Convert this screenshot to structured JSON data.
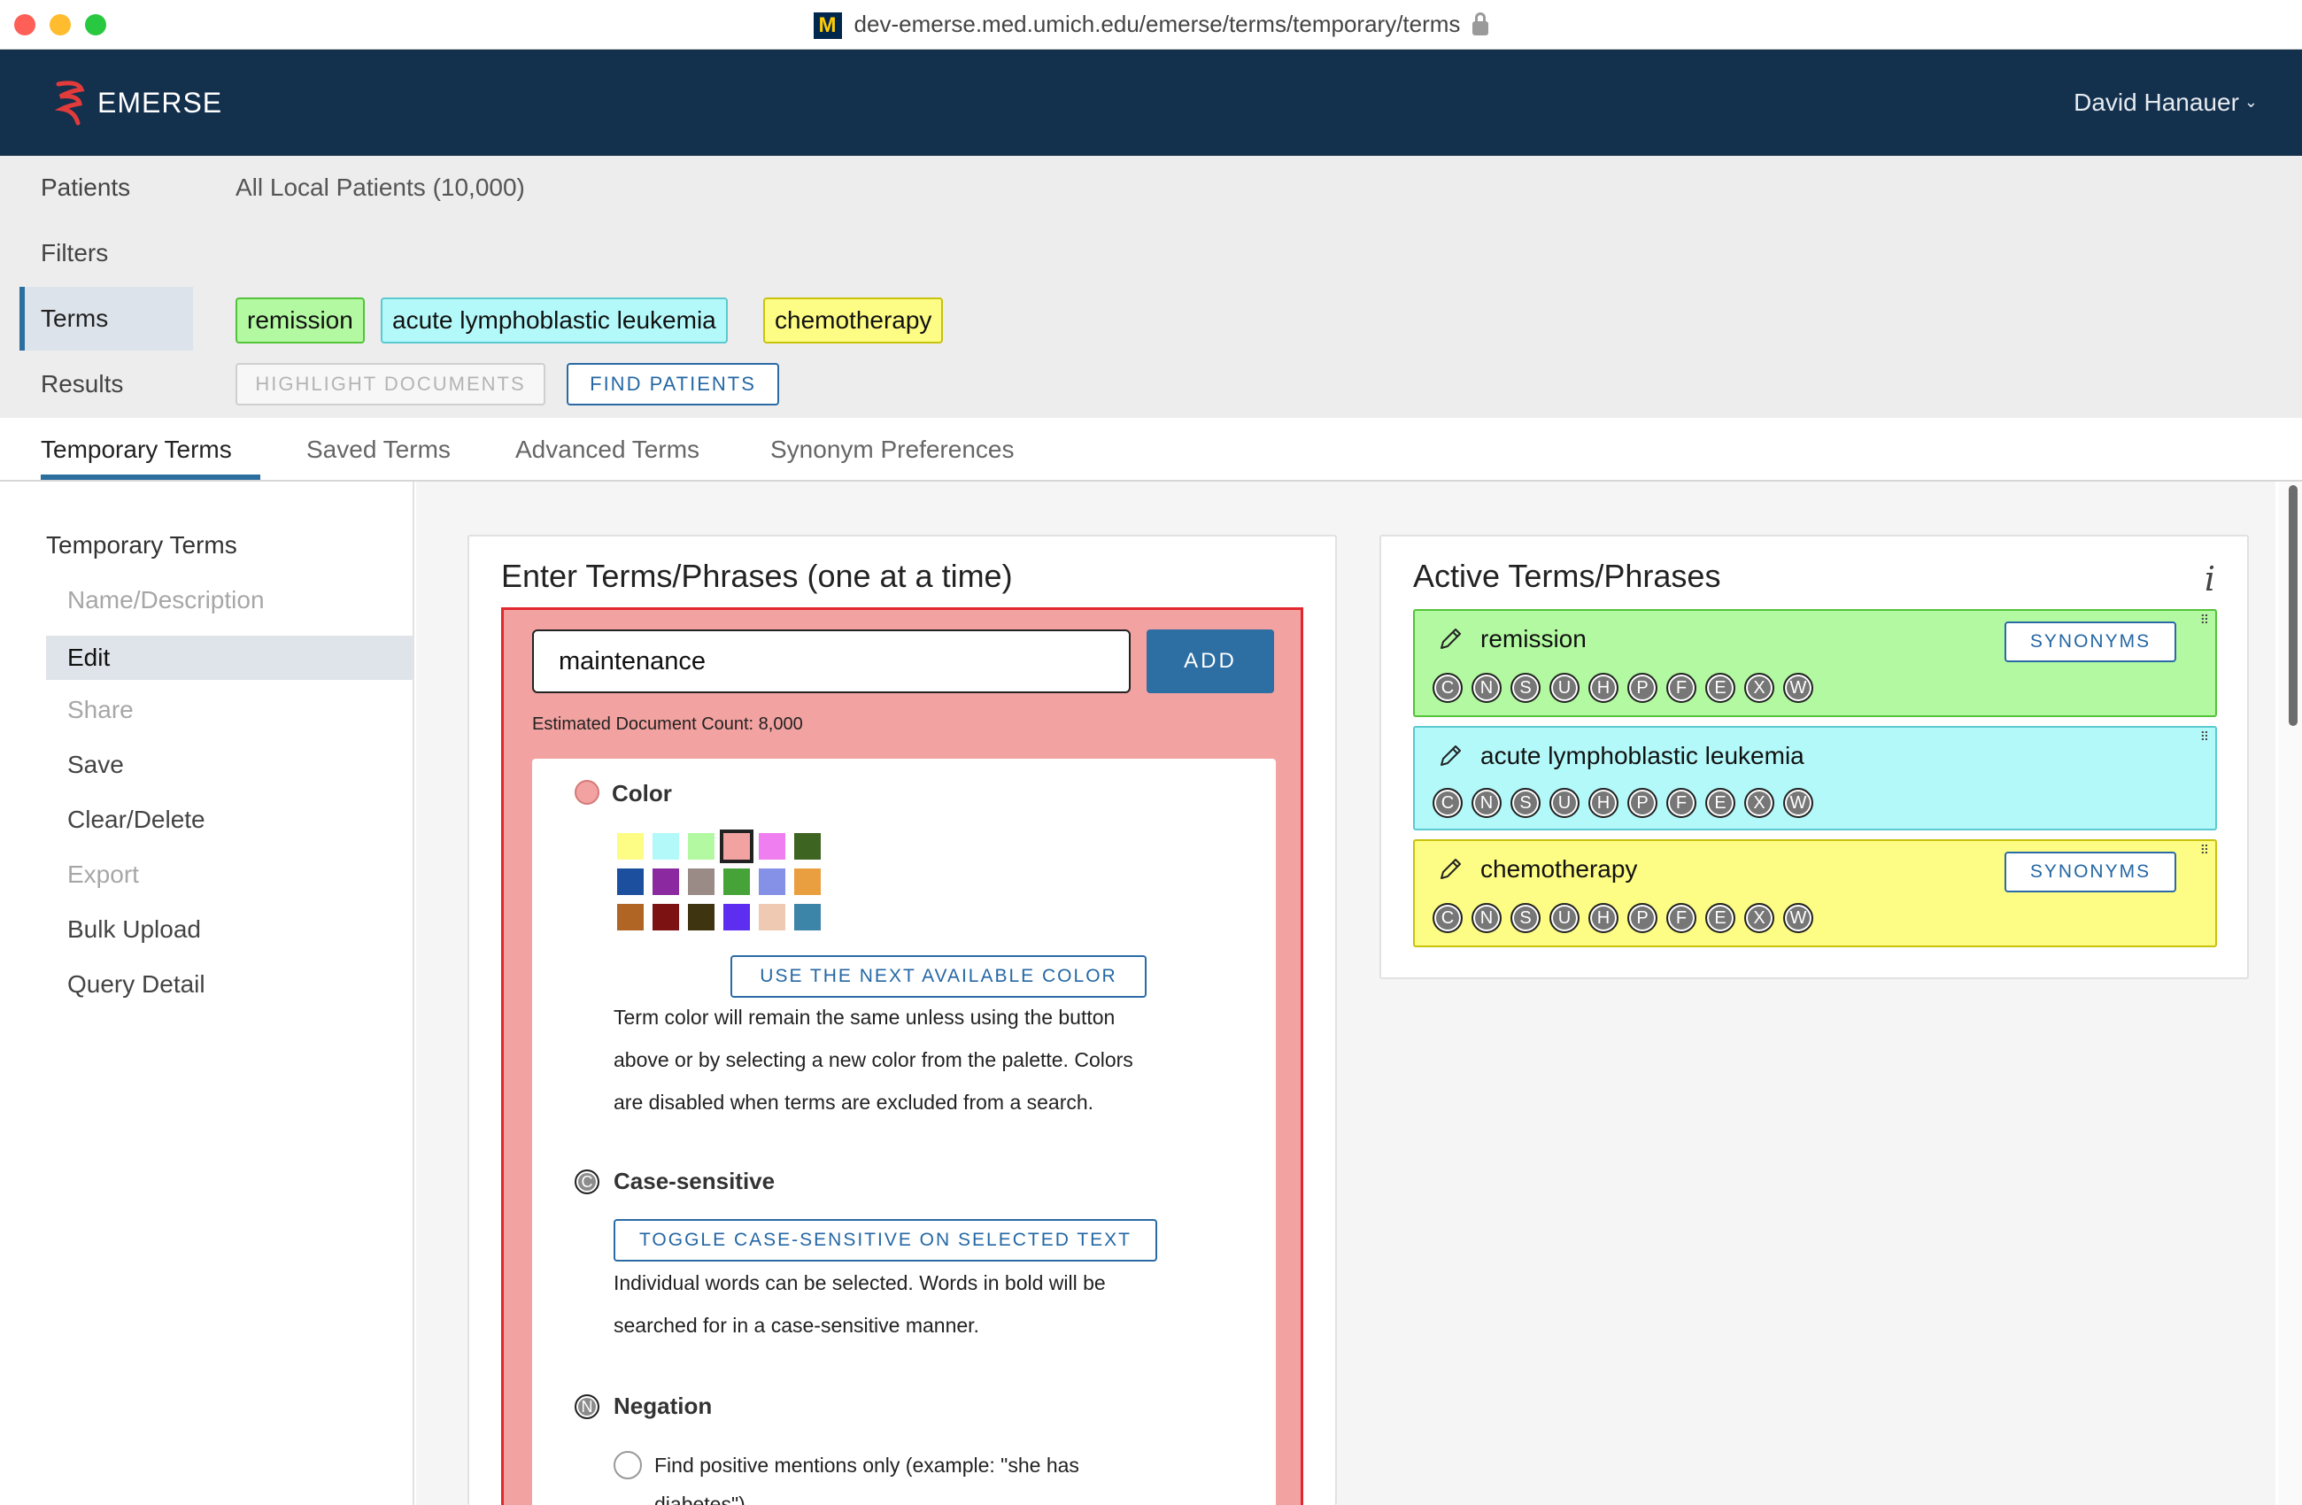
{
  "browser": {
    "favicon": "M",
    "url": "dev-emerse.med.umich.edu/emerse/terms/temporary/terms"
  },
  "header": {
    "app_name": "EMERSE",
    "user_name": "David Hanauer",
    "caret": "⌄"
  },
  "summary": {
    "patients_label": "Patients",
    "patients_value": "All Local Patients (10,000)",
    "filters_label": "Filters",
    "terms_label": "Terms",
    "results_label": "Results",
    "term_chips": [
      {
        "label": "remission",
        "color": "#b3f9a1",
        "border": "#54c23a"
      },
      {
        "label": "acute lymphoblastic leukemia",
        "color": "#b4f9fa",
        "border": "#5bc9cf"
      },
      {
        "label": "chemotherapy",
        "color": "#fdfc84",
        "border": "#c8c20d"
      }
    ],
    "highlight_btn": "HIGHLIGHT DOCUMENTS",
    "find_btn": "FIND PATIENTS"
  },
  "tabs": [
    "Temporary Terms",
    "Saved Terms",
    "Advanced Terms",
    "Synonym Preferences"
  ],
  "sidenav": {
    "title": "Temporary Terms",
    "items": [
      {
        "label": "Name/Description",
        "state": "disabled"
      },
      {
        "label": "Edit",
        "state": "active"
      },
      {
        "label": "Share",
        "state": "disabled"
      },
      {
        "label": "Save",
        "state": "normal"
      },
      {
        "label": "Clear/Delete",
        "state": "normal"
      },
      {
        "label": "Export",
        "state": "disabled"
      },
      {
        "label": "Bulk Upload",
        "state": "normal"
      },
      {
        "label": "Query Detail",
        "state": "normal"
      }
    ]
  },
  "enter": {
    "title": "Enter Terms/Phrases (one at a time)",
    "input_value": "maintenance",
    "add_btn": "ADD",
    "est_count": "Estimated Document Count: 8,000",
    "color_title": "Color",
    "selected_color": "#f2a2a0",
    "palette": [
      "#fdfc84",
      "#b4f9fa",
      "#b3f9a1",
      "#f2a2a0",
      "#ef7ef0",
      "#3e6421",
      "#1c4f9e",
      "#8b2aa0",
      "#9a8b86",
      "#46a338",
      "#8591e6",
      "#e99f3f",
      "#b06525",
      "#7c1212",
      "#3e3410",
      "#5d2ef0",
      "#efc9b1",
      "#3d84a9"
    ],
    "next_color_btn": "USE THE NEXT AVAILABLE COLOR",
    "color_text": [
      "Term color will remain the same unless using the button",
      "above or by selecting a new color from the palette. Colors",
      "are disabled when terms are excluded from a search."
    ],
    "case_icon": "C",
    "case_title": "Case-sensitive",
    "case_btn": "TOGGLE CASE-SENSITIVE ON SELECTED TEXT",
    "case_text": [
      "Individual words can be selected. Words in bold will be",
      "searched for in a case-sensitive manner."
    ],
    "neg_icon": "N",
    "neg_title": "Negation",
    "neg_option": [
      "Find positive mentions only (example: \"she has",
      "diabetes\")"
    ]
  },
  "active": {
    "title": "Active Terms/Phrases",
    "info_icon": "i",
    "synonyms_btn": "SYNONYMS",
    "drag_glyph": "⠿",
    "letters": [
      "C",
      "N",
      "S",
      "U",
      "H",
      "P",
      "F",
      "E",
      "X",
      "W"
    ],
    "terms": [
      {
        "label": "remission",
        "color": "#b3f9a1",
        "border": "#54c23a",
        "has_synonyms": true
      },
      {
        "label": "acute lymphoblastic leukemia",
        "color": "#b4f9fa",
        "border": "#5bc9cf",
        "has_synonyms": false
      },
      {
        "label": "chemotherapy",
        "color": "#fdfc84",
        "border": "#c8c20d",
        "has_synonyms": true
      }
    ]
  }
}
